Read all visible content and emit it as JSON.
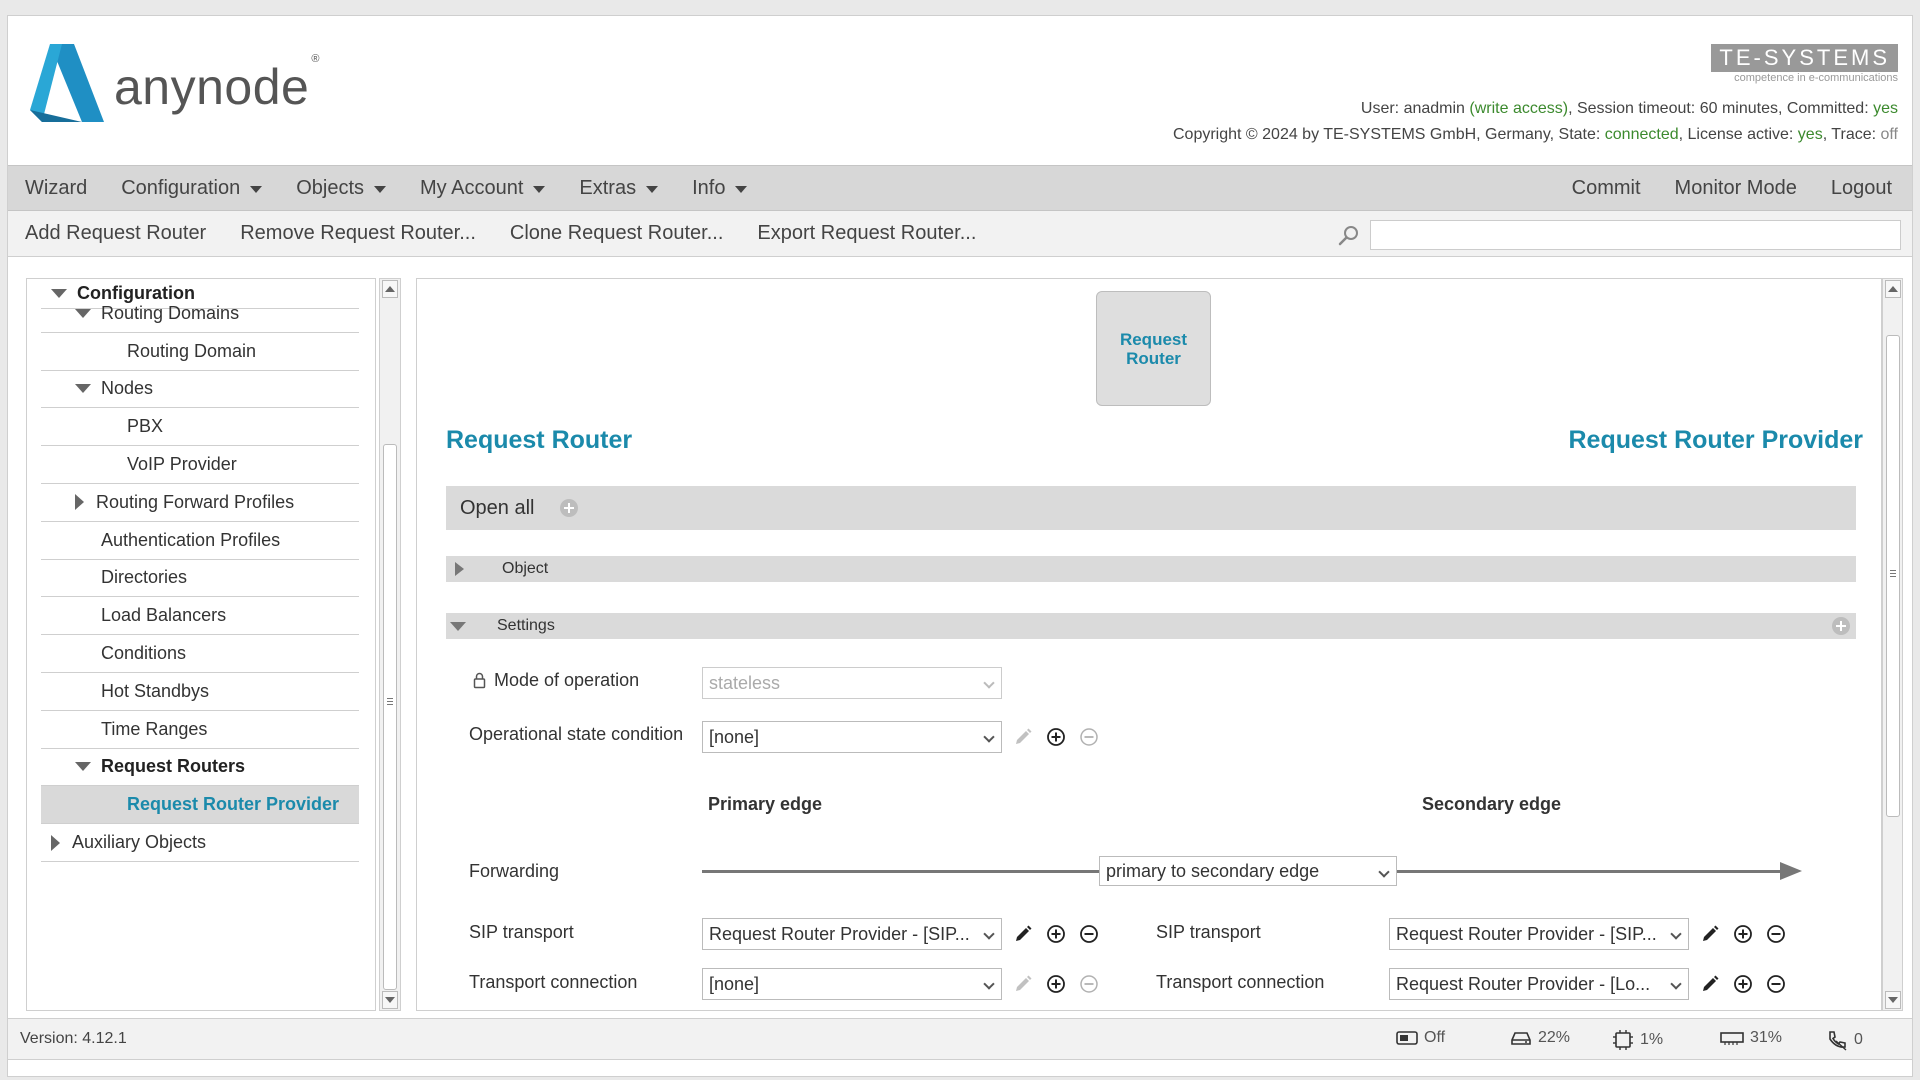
{
  "header": {
    "logo_text": "anynode",
    "logo_reg": "®",
    "brand_name": "TE-SYSTEMS",
    "brand_tagline": "competence in e-communications",
    "status_line1": {
      "user_label": "User: ",
      "user": "anadmin",
      "access": "(write access)",
      "session": ", Session timeout: 60 minutes, Committed: ",
      "committed": "yes"
    },
    "status_line2": {
      "copyright": "Copyright © 2024 by TE-SYSTEMS GmbH, Germany, State: ",
      "state": "connected",
      "license_label": ", License active: ",
      "license": "yes",
      "trace_label": ", Trace: ",
      "trace": "off"
    }
  },
  "menubar": {
    "left": [
      {
        "label": "Wizard",
        "dropdown": false
      },
      {
        "label": "Configuration",
        "dropdown": true
      },
      {
        "label": "Objects",
        "dropdown": true
      },
      {
        "label": "My Account",
        "dropdown": true
      },
      {
        "label": "Extras",
        "dropdown": true
      },
      {
        "label": "Info",
        "dropdown": true
      }
    ],
    "right": [
      "Commit",
      "Monitor Mode",
      "Logout"
    ]
  },
  "toolbar": {
    "items": [
      "Add Request Router",
      "Remove Request Router...",
      "Clone Request Router...",
      "Export Request Router..."
    ],
    "search_value": ""
  },
  "sidebar": {
    "items": [
      {
        "label": "Configuration",
        "indent": 0,
        "expander": "down",
        "bold": true,
        "selected": false
      },
      {
        "label": "Routing Domains",
        "indent": 1,
        "expander": "down",
        "bold": false,
        "selected": false
      },
      {
        "label": "Routing Domain",
        "indent": 2,
        "expander": "none",
        "bold": false,
        "selected": false
      },
      {
        "label": "Nodes",
        "indent": 1,
        "expander": "down",
        "bold": false,
        "selected": false
      },
      {
        "label": "PBX",
        "indent": 2,
        "expander": "none",
        "bold": false,
        "selected": false
      },
      {
        "label": "VoIP Provider",
        "indent": 2,
        "expander": "none",
        "bold": false,
        "selected": false
      },
      {
        "label": "Routing Forward Profiles",
        "indent": 1,
        "expander": "right",
        "bold": false,
        "selected": false
      },
      {
        "label": "Authentication Profiles",
        "indent": 1,
        "expander": "none",
        "bold": false,
        "selected": false
      },
      {
        "label": "Directories",
        "indent": 1,
        "expander": "none",
        "bold": false,
        "selected": false
      },
      {
        "label": "Load Balancers",
        "indent": 1,
        "expander": "none",
        "bold": false,
        "selected": false
      },
      {
        "label": "Conditions",
        "indent": 1,
        "expander": "none",
        "bold": false,
        "selected": false
      },
      {
        "label": "Hot Standbys",
        "indent": 1,
        "expander": "none",
        "bold": false,
        "selected": false
      },
      {
        "label": "Time Ranges",
        "indent": 1,
        "expander": "none",
        "bold": false,
        "selected": false
      },
      {
        "label": "Request Routers",
        "indent": 1,
        "expander": "down",
        "bold": true,
        "selected": false
      },
      {
        "label": "Request Router Provider",
        "indent": 2,
        "expander": "none",
        "bold": false,
        "selected": true
      },
      {
        "label": "Auxiliary Objects",
        "indent": 0,
        "expander": "right",
        "bold": false,
        "selected": false
      }
    ]
  },
  "main": {
    "node_box_label": "Request Router",
    "title_left": "Request Router",
    "title_right": "Request Router Provider",
    "open_all_label": "Open all",
    "sections": {
      "object": "Object",
      "settings": "Settings"
    },
    "mode_of_operation": {
      "label": "Mode of operation",
      "value": "stateless"
    },
    "operational_state": {
      "label": "Operational state condition",
      "value": "[none]"
    },
    "primary_edge_label": "Primary edge",
    "secondary_edge_label": "Secondary edge",
    "forwarding": {
      "label": "Forwarding",
      "value": "primary to secondary edge"
    },
    "primary": {
      "sip_transport": {
        "label": "SIP transport",
        "value": "Request Router Provider - [SIP..."
      },
      "transport_connection": {
        "label": "Transport connection",
        "value": "[none]"
      }
    },
    "secondary": {
      "sip_transport": {
        "label": "SIP transport",
        "value": "Request Router Provider - [SIP..."
      },
      "transport_connection": {
        "label": "Transport connection",
        "value": "Request Router Provider - [Lo..."
      }
    }
  },
  "footer": {
    "version_label": "Version:",
    "version": "4.12.1",
    "stats": [
      {
        "icon": "toggle-icon",
        "value": "Off"
      },
      {
        "icon": "disk-icon",
        "value": "22%"
      },
      {
        "icon": "cpu-icon",
        "value": "1%"
      },
      {
        "icon": "memory-icon",
        "value": "31%"
      },
      {
        "icon": "phone-icon",
        "value": "0"
      }
    ]
  },
  "colors": {
    "accent": "#1b8aab",
    "green": "#3c8a2e",
    "logo_blue": "#2596be"
  }
}
